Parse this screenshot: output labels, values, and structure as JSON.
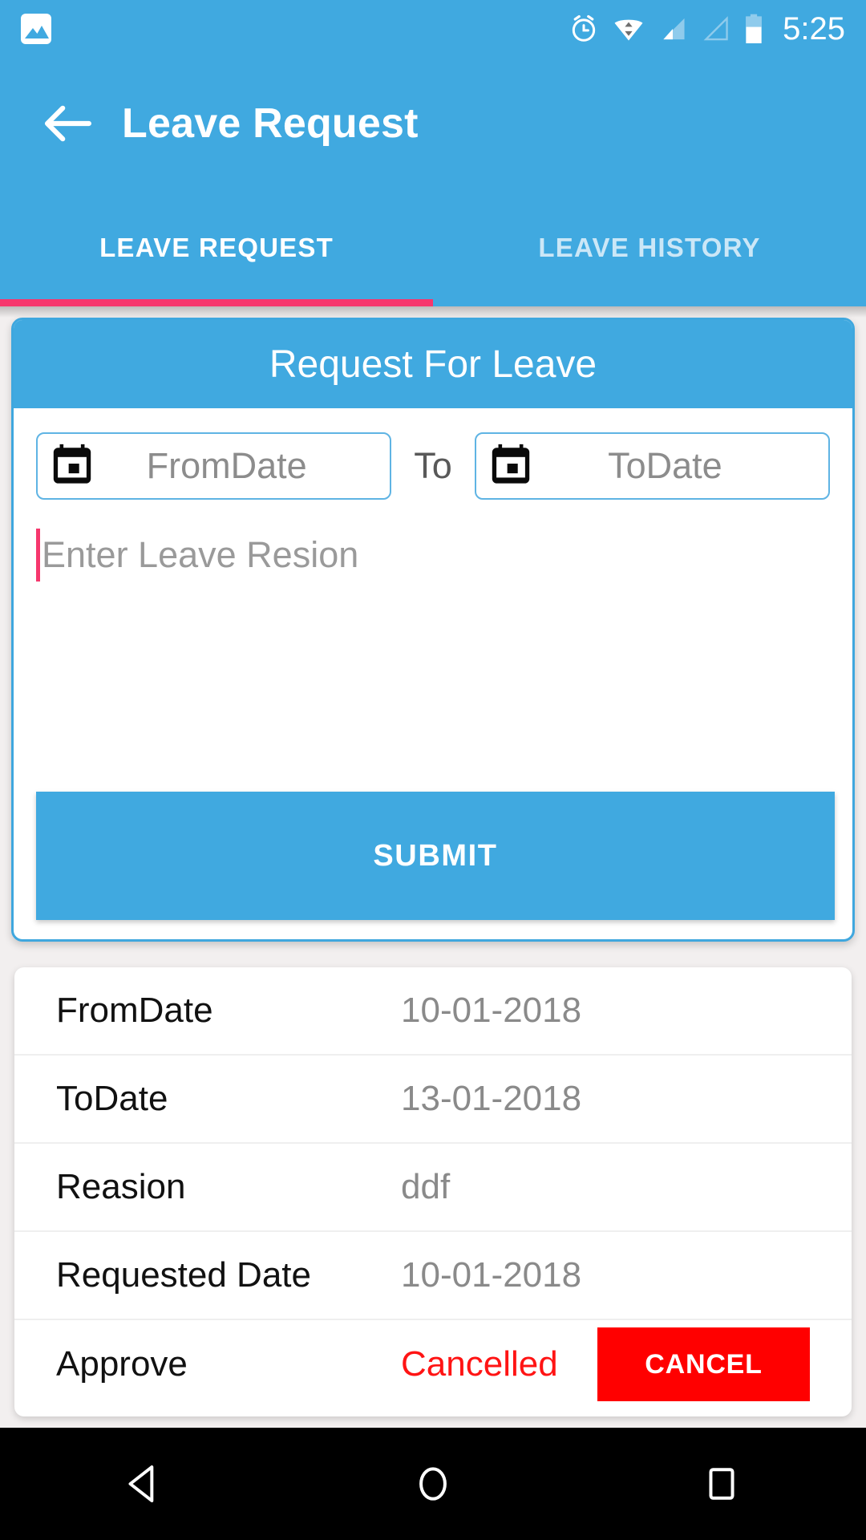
{
  "status_bar": {
    "notification_icon": "gallery-icon",
    "icons": [
      "alarm-icon",
      "wifi-icon",
      "signal-icon",
      "signal-icon-secondary",
      "battery-icon"
    ],
    "time": "5:25"
  },
  "app_bar": {
    "back_icon": "back-arrow-icon",
    "title": "Leave Request"
  },
  "tabs": [
    {
      "label": "LEAVE REQUEST",
      "active": true
    },
    {
      "label": "LEAVE HISTORY",
      "active": false
    }
  ],
  "form": {
    "header": "Request For Leave",
    "from_date": {
      "icon": "calendar-icon",
      "placeholder": "FromDate",
      "value": ""
    },
    "separator": "To",
    "to_date": {
      "icon": "calendar-icon",
      "placeholder": "ToDate",
      "value": ""
    },
    "reason": {
      "placeholder": "Enter Leave Resion",
      "value": ""
    },
    "submit_label": "SUBMIT"
  },
  "detail": {
    "rows": [
      {
        "label": "FromDate",
        "value": "10-01-2018"
      },
      {
        "label": "ToDate",
        "value": "13-01-2018"
      },
      {
        "label": "Reasion",
        "value": "ddf"
      },
      {
        "label": "Requested Date",
        "value": "10-01-2018"
      }
    ],
    "approve_label": "Approve",
    "status": "Cancelled",
    "cancel_button": "CANCEL"
  },
  "nav_bar": {
    "back": "nav-back-icon",
    "home": "nav-home-icon",
    "recents": "nav-recents-icon"
  },
  "colors": {
    "primary": "#40A9E0",
    "accent_pink": "#F6376D",
    "danger": "#FF0000",
    "status_text": "#FF1414",
    "page_bg": "#F2EFEF"
  }
}
